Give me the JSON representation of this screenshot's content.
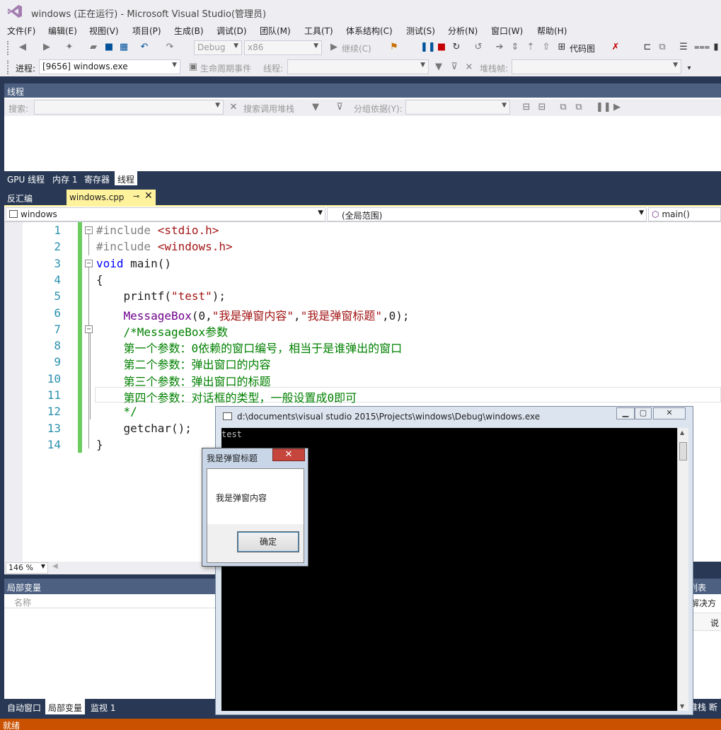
{
  "window": {
    "title": "windows (正在运行) - Microsoft Visual Studio(管理员)"
  },
  "menu": [
    "文件(F)",
    "编辑(E)",
    "视图(V)",
    "项目(P)",
    "生成(B)",
    "调试(D)",
    "团队(M)",
    "工具(T)",
    "体系结构(C)",
    "测试(S)",
    "分析(N)",
    "窗口(W)",
    "帮助(H)"
  ],
  "toolbar1": {
    "config": "Debug",
    "platform": "x86",
    "continue_label": "继续(C)",
    "code_map_label": "代码图"
  },
  "toolbar2": {
    "process_label": "进程:",
    "process_value": "[9656] windows.exe",
    "lifecycle_label": "生命周期事件",
    "thread_label": "线程:",
    "stack_label": "堆栈帧:"
  },
  "threads_panel": {
    "title": "线程",
    "search_label": "搜索:",
    "search_call_stack": "搜索调用堆栈",
    "group_by_label": "分组依据(Y):"
  },
  "debug_tabs": [
    "GPU 线程",
    "内存 1",
    "寄存器",
    "线程"
  ],
  "doc_tabs": {
    "disassembly": "反汇编",
    "active_file": "windows.cpp"
  },
  "nav_bar": {
    "project": "windows",
    "scope": "(全局范围)",
    "member": "main()"
  },
  "code_lines": [
    {
      "n": "1",
      "text": "#include <stdio.h>",
      "cls": "pp"
    },
    {
      "n": "2",
      "text": "#include <windows.h>",
      "cls": "pp"
    },
    {
      "n": "3",
      "text": "void main()",
      "cls": "kwline"
    },
    {
      "n": "4",
      "text": "{",
      "cls": ""
    },
    {
      "n": "5",
      "text": "    printf(\"test\");",
      "cls": "printf"
    },
    {
      "n": "6",
      "text": "    MessageBox(0,\"我是弹窗内容\",\"我是弹窗标题\",0);",
      "cls": "msgbox"
    },
    {
      "n": "7",
      "text": "    /*MessageBox参数",
      "cls": "cm"
    },
    {
      "n": "8",
      "text": "    第一个参数：0依赖的窗口编号，相当于是谁弹出的窗口",
      "cls": "cm"
    },
    {
      "n": "9",
      "text": "    第二个参数：弹出窗口的内容",
      "cls": "cm"
    },
    {
      "n": "10",
      "text": "    第三个参数：弹出窗口的标题",
      "cls": "cm"
    },
    {
      "n": "11",
      "text": "    第四个参数：对话框的类型，一般设置成0即可",
      "cls": "cm"
    },
    {
      "n": "12",
      "text": "    */",
      "cls": "cm"
    },
    {
      "n": "13",
      "text": "    getchar();",
      "cls": ""
    },
    {
      "n": "14",
      "text": "}",
      "cls": ""
    }
  ],
  "zoom": "146 %",
  "locals_panel": {
    "title": "局部变量",
    "column_name": "名称"
  },
  "bottom_tabs": [
    "自动窗口",
    "局部变量",
    "监视 1"
  ],
  "right_panel": {
    "title": "列表",
    "solution": "解决方",
    "col": "说",
    "tabs": "堆栈  断"
  },
  "status": "就绪",
  "console": {
    "title": "d:\\documents\\visual studio 2015\\Projects\\windows\\Debug\\windows.exe",
    "output": "test"
  },
  "message_box": {
    "title": "我是弹窗标题",
    "content": "我是弹窗内容",
    "ok_label": "确定"
  },
  "colors": {
    "panel_dark": "#293955",
    "status_bar": "#ca5100",
    "tab_active": "#fff29d",
    "change_bar": "#6ccc60"
  }
}
